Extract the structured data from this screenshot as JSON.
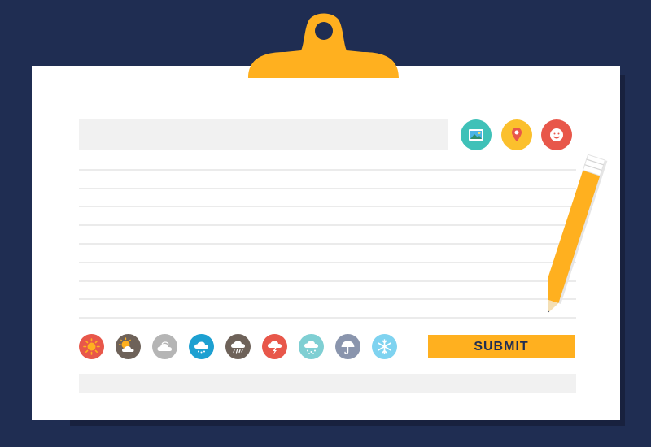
{
  "form": {
    "title_placeholder": "",
    "submit_label": "SUBMIT"
  },
  "attach_icons": [
    {
      "name": "image-icon",
      "color": "#3fc1b8"
    },
    {
      "name": "location-pin-icon",
      "color": "#fbc02d"
    },
    {
      "name": "emoji-icon",
      "color": "#e8574a"
    }
  ],
  "weather_icons": [
    {
      "name": "sunny-icon",
      "color": "#e8574a"
    },
    {
      "name": "partly-cloudy-icon",
      "color": "#6e6259"
    },
    {
      "name": "cloudy-icon",
      "color": "#b5b5b5"
    },
    {
      "name": "rain-icon",
      "color": "#1da0d1"
    },
    {
      "name": "heavy-rain-icon",
      "color": "#6e6259"
    },
    {
      "name": "thunderstorm-icon",
      "color": "#e8574a"
    },
    {
      "name": "snow-rain-icon",
      "color": "#7fcfd3"
    },
    {
      "name": "umbrella-icon",
      "color": "#8a95ad"
    },
    {
      "name": "snowflake-icon",
      "color": "#7fd3f0"
    }
  ],
  "colors": {
    "background": "#1f2d52",
    "paper": "#ffffff",
    "accent": "#ffb01f",
    "field": "#f1f1f1"
  }
}
